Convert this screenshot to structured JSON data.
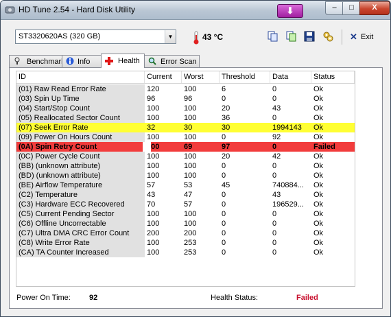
{
  "window": {
    "title": "HD Tune 2.54 - Hard Disk Utility"
  },
  "controls": {
    "minimize": "–",
    "maximize": "□",
    "close": "X"
  },
  "toolbar": {
    "drive": "ST3320620AS (320 GB)",
    "temperature": "43 °C",
    "exit_label": "Exit"
  },
  "tabs": [
    "Benchmark",
    "Info",
    "Health",
    "Error Scan"
  ],
  "active_tab": "Health",
  "table": {
    "columns": [
      "ID",
      "Current",
      "Worst",
      "Threshold",
      "Data",
      "Status"
    ],
    "rows": [
      {
        "id": "(01) Raw Read Error Rate",
        "current": "120",
        "worst": "100",
        "threshold": "6",
        "data": "0",
        "status": "Ok",
        "state": "normal"
      },
      {
        "id": "(03) Spin Up Time",
        "current": "96",
        "worst": "96",
        "threshold": "0",
        "data": "0",
        "status": "Ok",
        "state": "normal"
      },
      {
        "id": "(04) Start/Stop Count",
        "current": "100",
        "worst": "100",
        "threshold": "20",
        "data": "43",
        "status": "Ok",
        "state": "normal"
      },
      {
        "id": "(05) Reallocated Sector Count",
        "current": "100",
        "worst": "100",
        "threshold": "36",
        "data": "0",
        "status": "Ok",
        "state": "normal"
      },
      {
        "id": "(07) Seek Error Rate",
        "current": "32",
        "worst": "30",
        "threshold": "30",
        "data": "1994143",
        "status": "Ok",
        "state": "warn"
      },
      {
        "id": "(09) Power On Hours Count",
        "current": "100",
        "worst": "100",
        "threshold": "0",
        "data": "92",
        "status": "Ok",
        "state": "normal"
      },
      {
        "id": "(0A) Spin Retry Count",
        "current": "100",
        "worst": "69",
        "threshold": "97",
        "data": "0",
        "status": "Failed",
        "state": "fail"
      },
      {
        "id": "(0C) Power Cycle Count",
        "current": "100",
        "worst": "100",
        "threshold": "20",
        "data": "42",
        "status": "Ok",
        "state": "normal"
      },
      {
        "id": "(BB) (unknown attribute)",
        "current": "100",
        "worst": "100",
        "threshold": "0",
        "data": "0",
        "status": "Ok",
        "state": "normal"
      },
      {
        "id": "(BD) (unknown attribute)",
        "current": "100",
        "worst": "100",
        "threshold": "0",
        "data": "0",
        "status": "Ok",
        "state": "normal"
      },
      {
        "id": "(BE) Airflow Temperature",
        "current": "57",
        "worst": "53",
        "threshold": "45",
        "data": "740884...",
        "status": "Ok",
        "state": "normal"
      },
      {
        "id": "(C2) Temperature",
        "current": "43",
        "worst": "47",
        "threshold": "0",
        "data": "43",
        "status": "Ok",
        "state": "normal"
      },
      {
        "id": "(C3) Hardware ECC Recovered",
        "current": "70",
        "worst": "57",
        "threshold": "0",
        "data": "196529...",
        "status": "Ok",
        "state": "normal"
      },
      {
        "id": "(C5) Current Pending Sector",
        "current": "100",
        "worst": "100",
        "threshold": "0",
        "data": "0",
        "status": "Ok",
        "state": "normal"
      },
      {
        "id": "(C6) Offline Uncorrectable",
        "current": "100",
        "worst": "100",
        "threshold": "0",
        "data": "0",
        "status": "Ok",
        "state": "normal"
      },
      {
        "id": "(C7) Ultra DMA CRC Error Count",
        "current": "200",
        "worst": "200",
        "threshold": "0",
        "data": "0",
        "status": "Ok",
        "state": "normal"
      },
      {
        "id": "(C8) Write Error Rate",
        "current": "100",
        "worst": "253",
        "threshold": "0",
        "data": "0",
        "status": "Ok",
        "state": "normal"
      },
      {
        "id": "(CA) TA Counter Increased",
        "current": "100",
        "worst": "253",
        "threshold": "0",
        "data": "0",
        "status": "Ok",
        "state": "normal"
      }
    ]
  },
  "footer": {
    "power_on_time_label": "Power On Time:",
    "power_on_time_value": "92",
    "health_status_label": "Health Status:",
    "health_status_value": "Failed"
  },
  "colors": {
    "warn_row": "#ffff33",
    "fail_row": "#f23c3c",
    "failed_text": "#c8102e"
  }
}
